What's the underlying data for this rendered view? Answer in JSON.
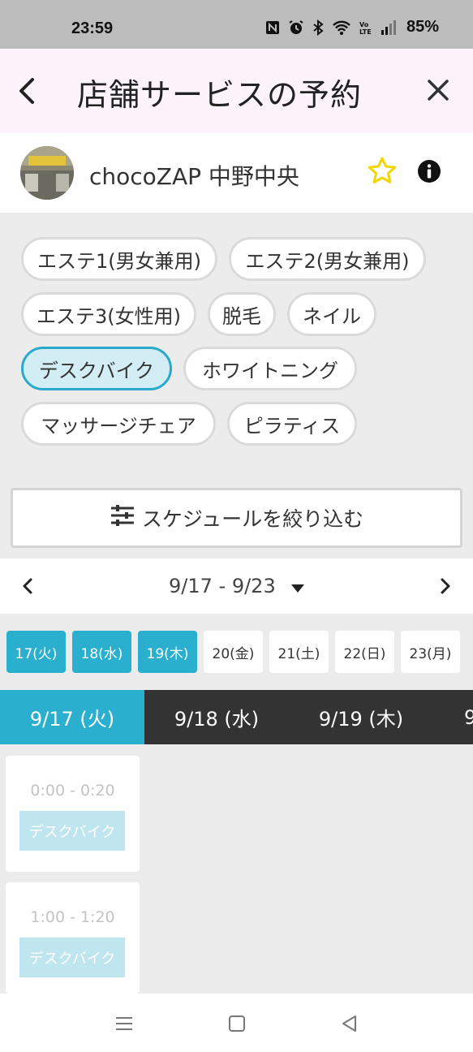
{
  "status": {
    "time": "23:59",
    "battery": "85%",
    "icons": [
      "nfc-icon",
      "alarm-icon",
      "bluetooth-icon",
      "wifi-icon",
      "volte-icon",
      "signal-icon"
    ]
  },
  "header": {
    "title": "店舗サービスの予約",
    "back_icon": "chevron-left-icon",
    "close_icon": "close-icon"
  },
  "store": {
    "name": "chocoZAP 中野中央",
    "favorite_icon": "star-outline-icon",
    "info_icon": "info-icon"
  },
  "services": [
    {
      "label": "エステ1(男女兼用)",
      "selected": false
    },
    {
      "label": "エステ2(男女兼用)",
      "selected": false
    },
    {
      "label": "エステ3(女性用)",
      "selected": false
    },
    {
      "label": "脱毛",
      "selected": false
    },
    {
      "label": "ネイル",
      "selected": false
    },
    {
      "label": "デスクバイク",
      "selected": true
    },
    {
      "label": "ホワイトニング",
      "selected": false
    },
    {
      "label": "マッサージチェア",
      "selected": false
    },
    {
      "label": "ピラティス",
      "selected": false
    }
  ],
  "filter": {
    "label": "スケジュールを絞り込む",
    "icon": "sliders-icon"
  },
  "week": {
    "range": "9/17 - 9/23",
    "prev_icon": "chevron-left-icon",
    "next_icon": "chevron-right-icon",
    "dropdown_icon": "caret-down-icon"
  },
  "days": [
    {
      "label": "17(火)",
      "active": true
    },
    {
      "label": "18(水)",
      "active": true
    },
    {
      "label": "19(木)",
      "active": true
    },
    {
      "label": "20(金)",
      "active": false
    },
    {
      "label": "21(土)",
      "active": false
    },
    {
      "label": "22(日)",
      "active": false
    },
    {
      "label": "23(月)",
      "active": false
    }
  ],
  "tabs": [
    {
      "label": "9/17 (火)",
      "active": true
    },
    {
      "label": "9/18 (水)",
      "active": false
    },
    {
      "label": "9/19 (木)",
      "active": false
    },
    {
      "label": "9",
      "active": false
    }
  ],
  "slots": [
    {
      "time": "0:00 - 0:20",
      "service": "デスクバイク"
    },
    {
      "time": "1:00 - 1:20",
      "service": "デスクバイク"
    }
  ],
  "nav": {
    "icons": [
      "menu-icon",
      "home-square-icon",
      "back-triangle-icon"
    ]
  },
  "colors": {
    "accent": "#2bafcf",
    "selected_chip_bg": "#d2eef4",
    "header_bg": "#fdf4fb",
    "tab_bg": "#333333",
    "star": "#f2d600"
  }
}
